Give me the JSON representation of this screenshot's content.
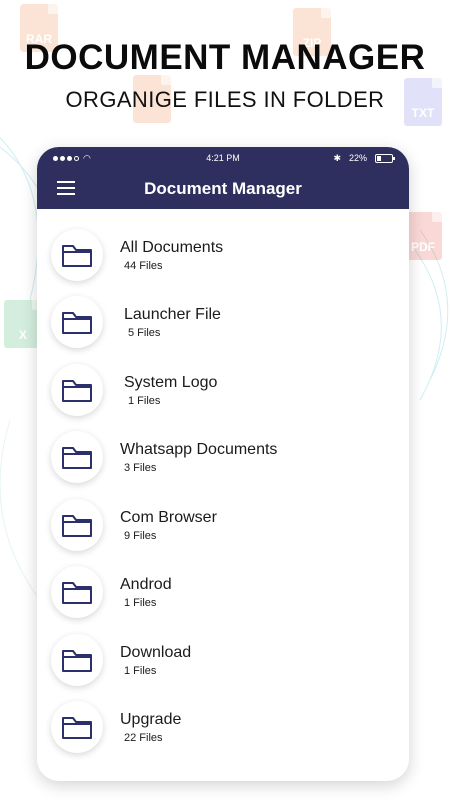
{
  "promo": {
    "title": "DOCUMENT MANAGER",
    "subtitle": "ORGANIGE FILES IN FOLDER"
  },
  "background_icons": [
    {
      "label": "RAR",
      "color": "#f08a4b"
    },
    {
      "label": "ZIP",
      "color": "#f08a4b"
    },
    {
      "label": "TXT",
      "color": "#7b7fe8"
    },
    {
      "label": "PDF",
      "color": "#e8534b"
    },
    {
      "label": "X",
      "color": "#3fb36b"
    }
  ],
  "phone": {
    "status_bar": {
      "time": "4:21 PM",
      "battery": "22%"
    },
    "app_bar": {
      "title": "Document Manager",
      "menu_icon": "hamburger-menu-icon"
    },
    "folders": [
      {
        "name": "All Documents",
        "count": "44 Files"
      },
      {
        "name": "Launcher File",
        "count": "5 Files"
      },
      {
        "name": "System Logo",
        "count": "1 Files"
      },
      {
        "name": "Whatsapp Documents",
        "count": "3 Files"
      },
      {
        "name": "Com Browser",
        "count": "9 Files"
      },
      {
        "name": "Androd",
        "count": "1 Files"
      },
      {
        "name": "Download",
        "count": "1 Files"
      },
      {
        "name": "Upgrade",
        "count": "22 Files"
      }
    ]
  },
  "colors": {
    "brand": "#2f2f5f",
    "folder_icon": "#2b2f6b"
  }
}
